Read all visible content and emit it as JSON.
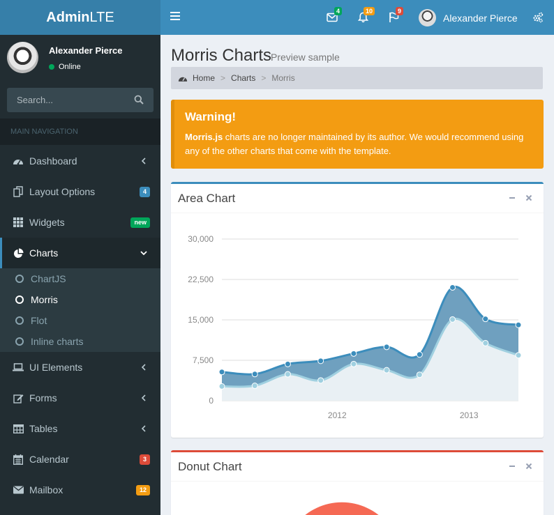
{
  "header": {
    "logo_bold": "Admin",
    "logo_rest": "LTE",
    "notifications": [
      {
        "icon": "envelope-icon",
        "count": "4",
        "color": "#00a65a"
      },
      {
        "icon": "bell-icon",
        "count": "10",
        "color": "#f39c12"
      },
      {
        "icon": "flag-icon",
        "count": "9",
        "color": "#dd4b39"
      }
    ],
    "user_name": "Alexander Pierce"
  },
  "sidebar": {
    "user_name": "Alexander Pierce",
    "status": "Online",
    "search_placeholder": "Search...",
    "nav_header": "MAIN NAVIGATION",
    "items": [
      {
        "label": "Dashboard",
        "icon": "dashboard-icon",
        "has_arrow": true
      },
      {
        "label": "Layout Options",
        "icon": "files-icon",
        "badge": "4",
        "badge_color": "#3c8dbc"
      },
      {
        "label": "Widgets",
        "icon": "th-icon",
        "badge": "new",
        "badge_color": "#00a65a"
      },
      {
        "label": "Charts",
        "icon": "pie-chart-icon",
        "active": true,
        "expanded": true
      },
      {
        "label": "UI Elements",
        "icon": "laptop-icon",
        "has_arrow": true
      },
      {
        "label": "Forms",
        "icon": "edit-icon",
        "has_arrow": true
      },
      {
        "label": "Tables",
        "icon": "table-icon",
        "has_arrow": true
      },
      {
        "label": "Calendar",
        "icon": "calendar-icon",
        "badge": "3",
        "badge_color": "#dd4b39"
      },
      {
        "label": "Mailbox",
        "icon": "envelope-icon",
        "badge": "12",
        "badge_color": "#f39c12"
      }
    ],
    "charts_sub": [
      {
        "label": "ChartJS"
      },
      {
        "label": "Morris",
        "active": true
      },
      {
        "label": "Flot"
      },
      {
        "label": "Inline charts"
      }
    ]
  },
  "content": {
    "title": "Morris Charts",
    "subtitle": "Preview sample",
    "breadcrumb": [
      "Home",
      "Charts",
      "Morris"
    ],
    "warning_title": "Warning!",
    "warning_bold": "Morris.js",
    "warning_text": " charts are no longer maintained by its author. We would recommend using any of the other charts that come with the template.",
    "area_title": "Area Chart",
    "donut_title": "Donut Chart"
  },
  "chart_data": {
    "type": "area",
    "x_tick_labels": [
      "2012",
      "2013"
    ],
    "y_ticks": [
      0,
      7500,
      15000,
      22500,
      30000
    ],
    "y_tick_labels": [
      "0",
      "7,500",
      "15,000",
      "22,500",
      "30,000"
    ],
    "ylim": [
      0,
      30000
    ],
    "x": [
      "2011 Q1",
      "2011 Q2",
      "2011 Q3",
      "2011 Q4",
      "2012 Q1",
      "2012 Q2",
      "2012 Q3",
      "2012 Q4",
      "2013 Q1",
      "2013 Q2"
    ],
    "series": [
      {
        "values": [
          2666,
          2778,
          4912,
          3767,
          6810,
          5670,
          4820,
          15073,
          10687,
          8432
        ],
        "color": "#a0d0e0"
      },
      {
        "values": [
          5332,
          4942,
          6807,
          7387,
          8750,
          9980,
          8570,
          21018,
          15176,
          14067
        ],
        "color": "#3c8dbc"
      }
    ],
    "grid": true
  }
}
